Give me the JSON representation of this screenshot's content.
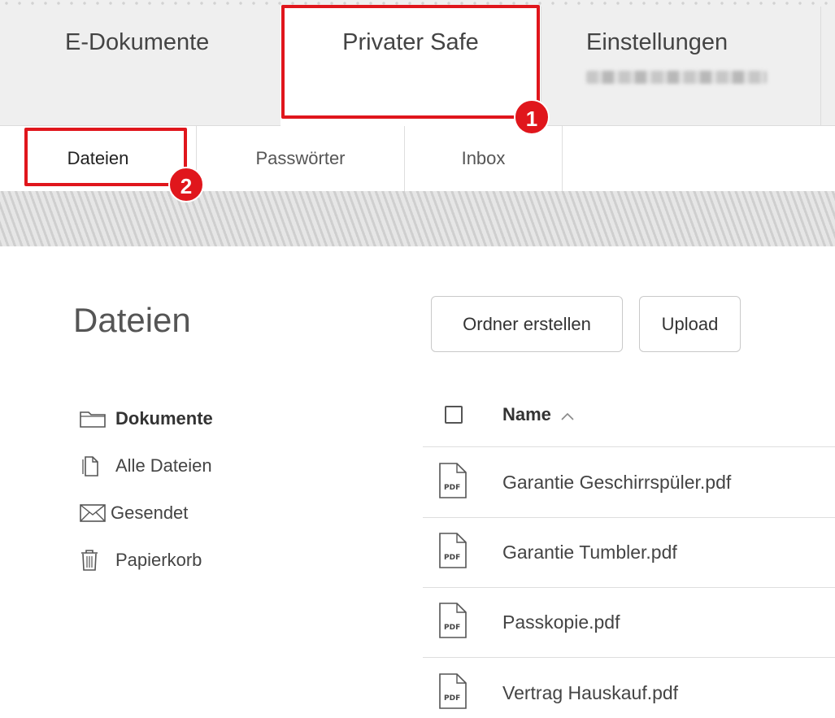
{
  "top_tabs": [
    {
      "label": "E-Dokumente"
    },
    {
      "label": "Privater Safe"
    },
    {
      "label": "Einstellungen"
    }
  ],
  "sub_tabs": [
    {
      "label": "Dateien"
    },
    {
      "label": "Passwörter"
    },
    {
      "label": "Inbox"
    }
  ],
  "annotations": {
    "badge1": "1",
    "badge2": "2",
    "color": "#e0161c"
  },
  "main": {
    "title": "Dateien",
    "buttons": {
      "create_folder": "Ordner erstellen",
      "upload": "Upload"
    }
  },
  "folders": [
    {
      "label": "Dokumente",
      "icon": "folder-icon"
    },
    {
      "label": "Alle Dateien",
      "icon": "document-copy-icon"
    },
    {
      "label": "Gesendet",
      "icon": "envelope-icon"
    },
    {
      "label": "Papierkorb",
      "icon": "trash-icon"
    }
  ],
  "file_table": {
    "column_name": "Name",
    "sort_glyph": "^",
    "files": [
      {
        "name": "Garantie Geschirrspüler.pdf",
        "type": "PDF"
      },
      {
        "name": "Garantie Tumbler.pdf",
        "type": "PDF"
      },
      {
        "name": "Passkopie.pdf",
        "type": "PDF"
      },
      {
        "name": "Vertrag Hauskauf.pdf",
        "type": "PDF"
      }
    ]
  }
}
